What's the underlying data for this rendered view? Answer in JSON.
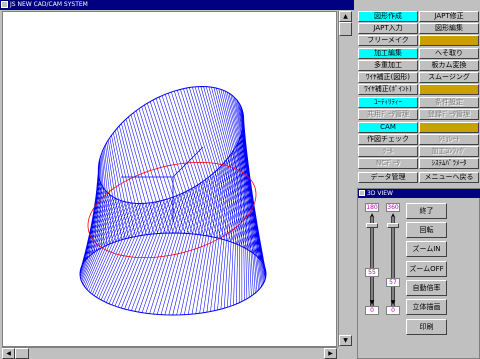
{
  "main_window": {
    "title": "JS NEW CAD/CAM SYSTEM"
  },
  "menu": {
    "zukei_sakusei": "図形作成",
    "japt_shusei": "JAPT修正",
    "japt_nyuryoku": "JAPT入力",
    "zukei_henshu": "図形編集",
    "free_make": "フリーメイク",
    "kako_henshu": "加工編集",
    "hesodori": "へそ取り",
    "tadan_kako": "多重加工",
    "ita_cam_henkan": "板カム変換",
    "wire_hosei_zukei": "ﾜｲﾔ補正(図形)",
    "smoothing": "スムージング",
    "wire_hosei_point": "ﾜｲﾔ補正(ﾎﾟｲﾝﾄ)",
    "utility": "ﾕｰﾃｨﾘﾃｨｰ",
    "dis_1": "条件設定",
    "dis_2": "共用ﾃﾞｰﾀ管理",
    "dis_3": "登録ﾃﾞｰﾀ管理",
    "cam": "CAM",
    "sakuzu_check": "作図チェック",
    "dis_4": "ｼﾐｭﾚｰﾄ",
    "dis_5": "ﾂｰﾙ",
    "dis_6": "加工ｺﾝﾌｨｸﾞ",
    "dis_7": "NCﾃﾞｰﾀ",
    "system_parameter": "ｼｽﾃﾑﾊﾟﾗﾒｰﾀ",
    "data_kanri": "データ管理",
    "menu_modoru": "メニューへ戻る"
  },
  "view_window": {
    "title": "3D VIEW",
    "slider1": {
      "max": "180",
      "value": "55",
      "min": "0"
    },
    "slider2": {
      "max": "360",
      "value": "57",
      "min": "0"
    },
    "buttons": {
      "end": "終了",
      "rotate": "回転",
      "zoom_in": "ズームIN",
      "zoom_off": "ズームOFF",
      "auto_scale": "自動倍率",
      "solid_draw": "立体描画",
      "print": "印刷"
    }
  },
  "colors": {
    "wire": "#0000ff",
    "section": "#ff0000",
    "title_bar": "#000080",
    "highlight": "#00ffff",
    "disabled_bg": "#c8a000"
  }
}
